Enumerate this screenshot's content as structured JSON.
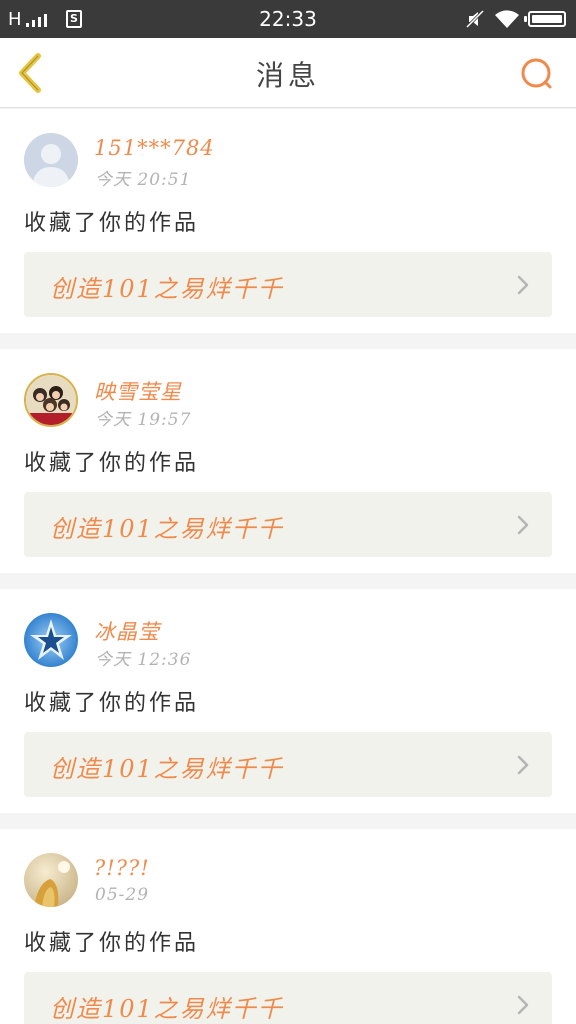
{
  "status_bar": {
    "network": "H",
    "sim_label": "S",
    "time": "22:33"
  },
  "header": {
    "title": "消息"
  },
  "messages": [
    {
      "username": "151***784",
      "time": "今天 20:51",
      "action": "收藏了你的作品",
      "work_title": "创造101之易烊千千",
      "avatar": "default-person-avatar"
    },
    {
      "username": "映雪莹星",
      "time": "今天 19:57",
      "action": "收藏了你的作品",
      "work_title": "创造101之易烊千千",
      "avatar": "group-photo-avatar"
    },
    {
      "username": "冰晶莹",
      "time": "今天 12:36",
      "action": "收藏了你的作品",
      "work_title": "创造101之易烊千千",
      "avatar": "blue-star-avatar"
    },
    {
      "username": "?!??!",
      "time": "05-29",
      "action": "收藏了你的作品",
      "work_title": "创造101之易烊千千",
      "avatar": "golden-photo-avatar"
    }
  ],
  "colors": {
    "accent": "#f08a4b",
    "back_icon": "#e8c43a",
    "status_bar": "#3a3a3a",
    "card_work_bg": "#f2f2ec"
  }
}
